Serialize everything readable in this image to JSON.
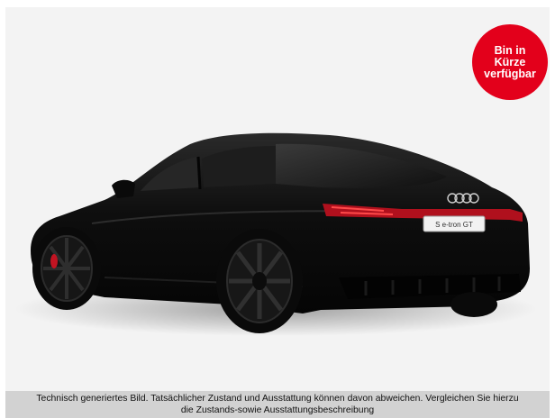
{
  "badge": {
    "text": "Bin in\nKürze\nverfügbar",
    "color": "#e3001b"
  },
  "vehicle": {
    "plate_text": "S e-tron GT",
    "paint_color": "#0b0b0b"
  },
  "disclaimer": {
    "line1": "Technisch generiertes Bild. Tatsächlicher Zustand und Ausstattung können davon abweichen. Vergleichen Sie hierzu",
    "line2": "die Zustands-sowie Ausstattungsbeschreibung"
  }
}
